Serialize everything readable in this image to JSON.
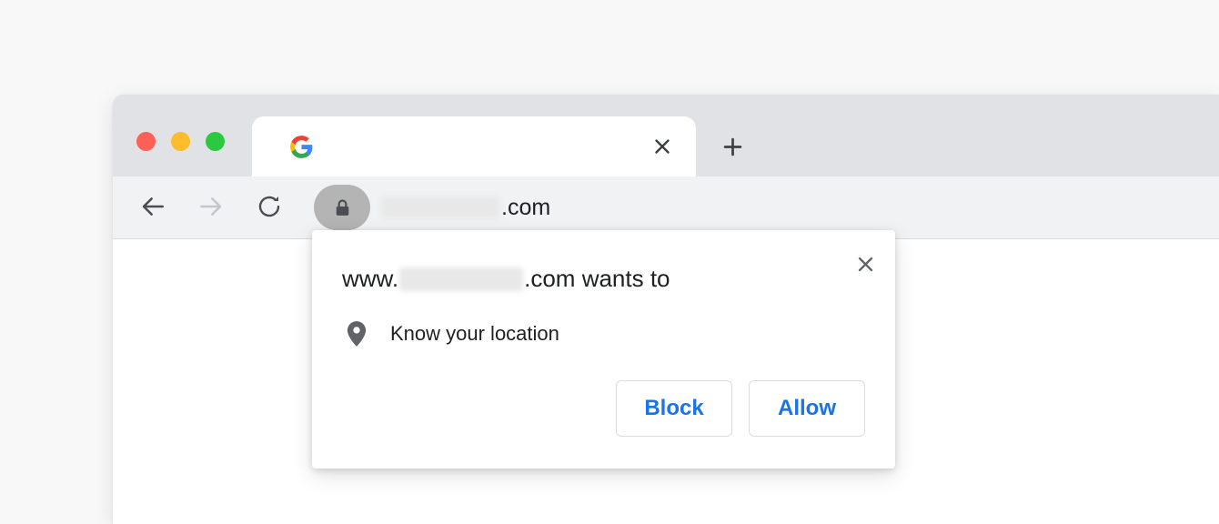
{
  "window": {
    "traffic_lights": [
      {
        "name": "close",
        "color": "#ff6058"
      },
      {
        "name": "minimize",
        "color": "#fdbc2c"
      },
      {
        "name": "maximize",
        "color": "#2bc840"
      }
    ]
  },
  "tab_strip": {
    "active_tab": {
      "favicon": "google-g-icon",
      "title": "",
      "close_icon": "close-icon"
    },
    "new_tab_icon": "plus-icon"
  },
  "toolbar": {
    "back_icon": "arrow-left-icon",
    "forward_icon": "arrow-right-icon",
    "reload_icon": "reload-icon",
    "site_info_icon": "lock-icon",
    "omnibox": {
      "redacted_host": "",
      "visible_suffix": ".com"
    }
  },
  "dialog": {
    "close_icon": "close-icon",
    "title_prefix": "www.",
    "title_redacted": "",
    "title_suffix": ".com wants to",
    "permission": {
      "icon": "location-pin-icon",
      "label": "Know your location"
    },
    "buttons": {
      "block_label": "Block",
      "allow_label": "Allow"
    },
    "accent_color": "#1a73e8"
  }
}
